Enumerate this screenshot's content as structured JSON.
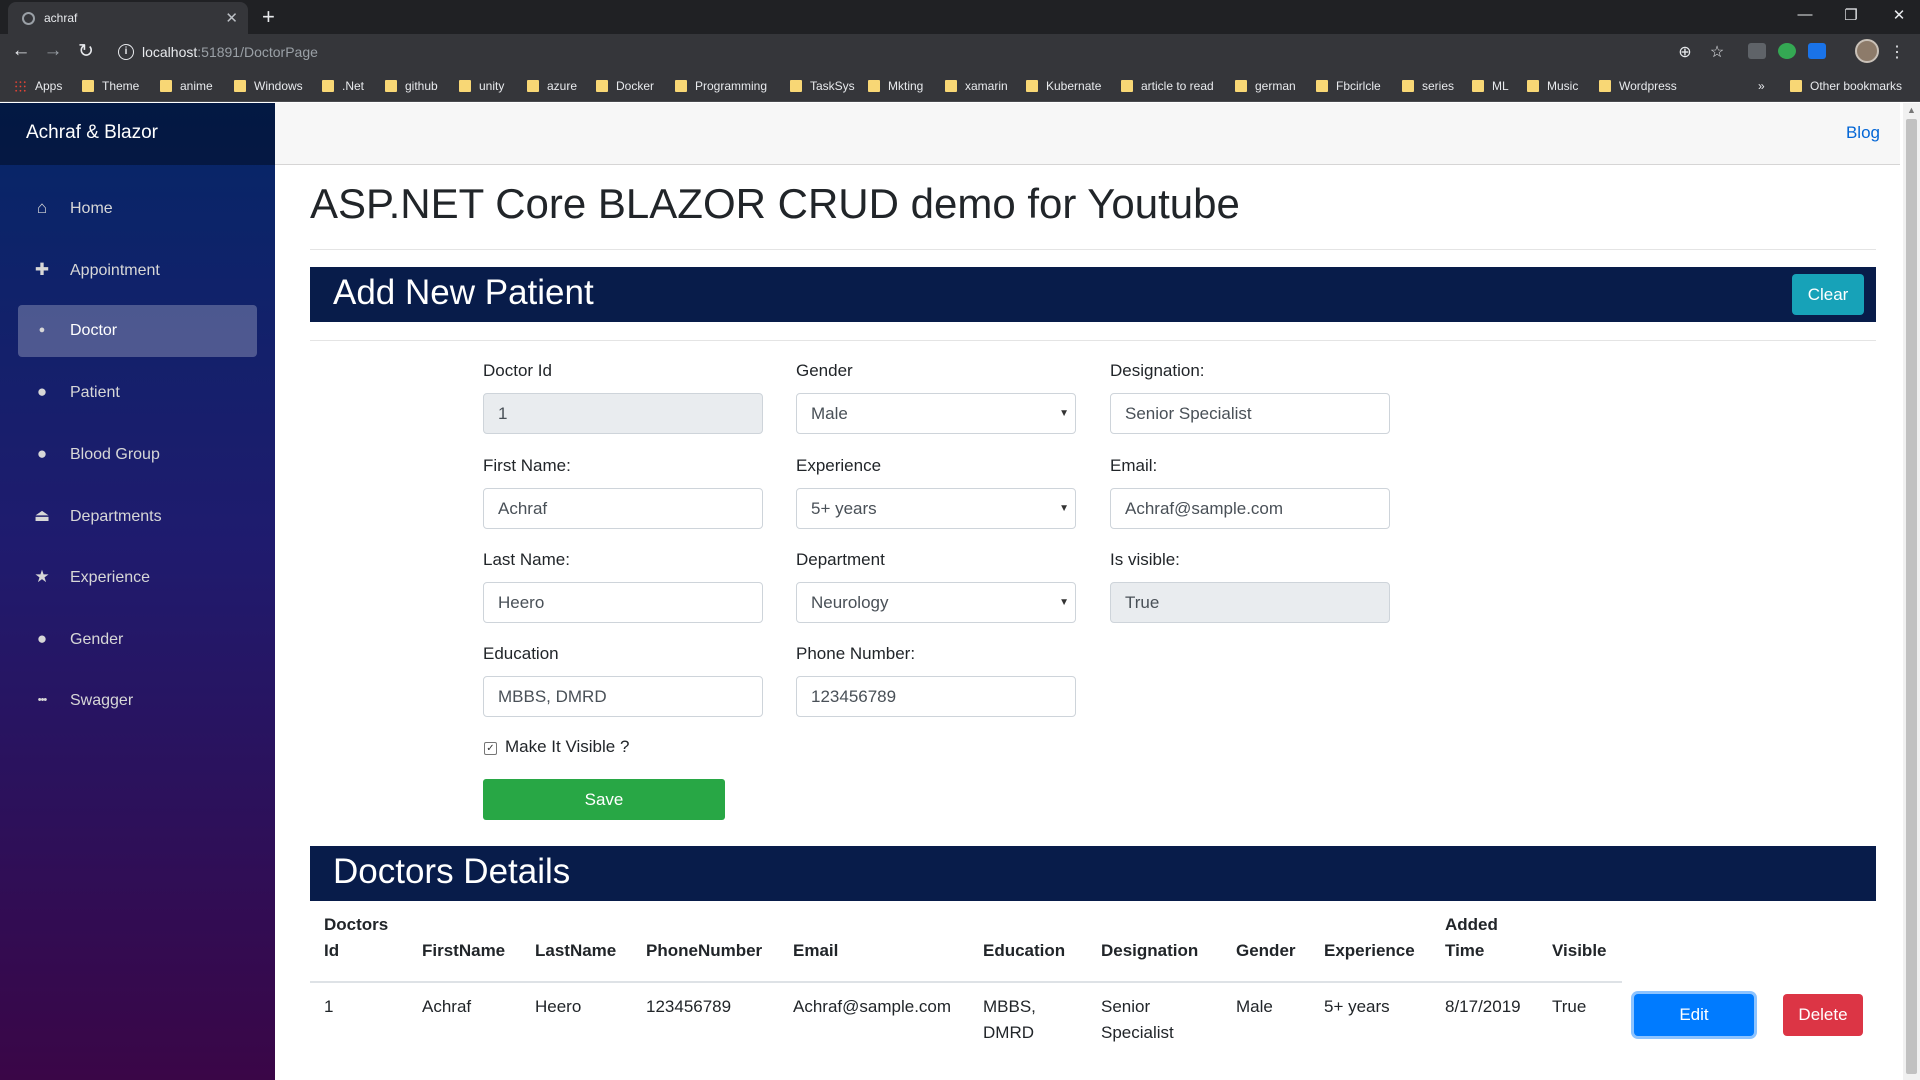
{
  "browser": {
    "tab_title": "achraf",
    "tab_close": "✕",
    "new_tab": "+",
    "url_host": "localhost",
    "url_rest": ":51891/DoctorPage",
    "window_controls": [
      "—",
      "❐",
      "✕"
    ],
    "bookmarks": [
      "Apps",
      "Theme",
      "anime",
      "Windows",
      ".Net",
      "github",
      "unity",
      "azure",
      "Docker",
      "Programming",
      "TaskSys",
      "Mkting",
      "xamarin",
      "Kubernate",
      "article to read",
      "german",
      "Fbcirlcle",
      "series",
      "ML",
      "Music",
      "Wordpress"
    ],
    "bookmarks_more": "»",
    "other_bookmarks": "Other bookmarks"
  },
  "sidebar": {
    "brand": "Achraf & Blazor",
    "items": [
      {
        "label": "Home",
        "icon": "home-icon",
        "glyph": "⌂"
      },
      {
        "label": "Appointment",
        "icon": "plus-icon",
        "glyph": "✚"
      },
      {
        "label": "Doctor",
        "icon": "person-icon",
        "glyph": "●"
      },
      {
        "label": "Patient",
        "icon": "person-icon",
        "glyph": "●"
      },
      {
        "label": "Blood Group",
        "icon": "droplet-icon",
        "glyph": "●"
      },
      {
        "label": "Departments",
        "icon": "eject-icon",
        "glyph": "⏏"
      },
      {
        "label": "Experience",
        "icon": "star-icon",
        "glyph": "★"
      },
      {
        "label": "Gender",
        "icon": "people-icon",
        "glyph": "●"
      },
      {
        "label": "Swagger",
        "icon": "ellipsis-icon",
        "glyph": "•••"
      }
    ],
    "active": "Doctor"
  },
  "header": {
    "blog_label": "Blog"
  },
  "page_title": "ASP.NET Core BLAZOR CRUD demo for Youtube",
  "form": {
    "title": "Add New Patient",
    "clear_label": "Clear",
    "doctor_id_label": "Doctor Id",
    "doctor_id_value": "1",
    "gender_label": "Gender",
    "gender_value": "Male",
    "designation_label": "Designation:",
    "designation_value": "Senior Specialist",
    "first_name_label": "First Name:",
    "first_name_value": "Achraf",
    "experience_label": "Experience",
    "experience_value": "5+ years",
    "email_label": "Email:",
    "email_value": "Achraf@sample.com",
    "last_name_label": "Last Name:",
    "last_name_value": "Heero",
    "department_label": "Department",
    "department_value": "Neurology",
    "is_visible_label": "Is visible:",
    "is_visible_value": "True",
    "education_label": "Education",
    "education_value": "MBBS, DMRD",
    "phone_label": "Phone Number:",
    "phone_value": "123456789",
    "visible_checkbox_label": "Make It Visible ?",
    "visible_checked": true,
    "save_label": "Save"
  },
  "table": {
    "title": "Doctors Details",
    "headers": [
      "Doctors Id",
      "FirstName",
      "LastName",
      "PhoneNumber",
      "Email",
      "Education",
      "Designation",
      "Gender",
      "Experience",
      "Added Time",
      "Visible"
    ],
    "rows": [
      [
        "1",
        "Achraf",
        "Heero",
        "123456789",
        "Achraf@sample.com",
        "MBBS, DMRD",
        "Senior Specialist",
        "Male",
        "5+ years",
        "8/17/2019",
        "True"
      ]
    ],
    "edit_label": "Edit",
    "delete_label": "Delete"
  },
  "colors": {
    "sidebar_top": "#052767",
    "sidebar_bottom": "#3a0647",
    "section_header": "#081c4a",
    "clear_button": "#17a2b8",
    "save_button": "#28a745",
    "edit_button": "#007bff",
    "delete_button": "#dc3545",
    "link": "#0366d6"
  }
}
